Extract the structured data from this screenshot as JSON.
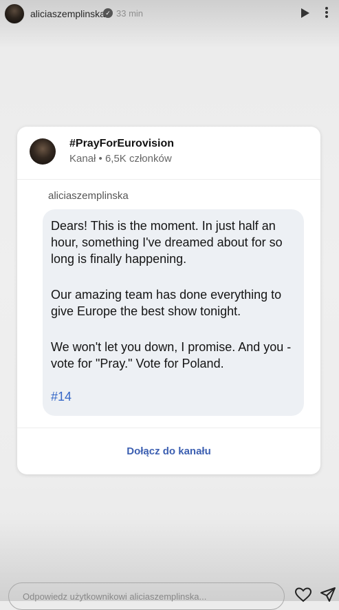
{
  "header": {
    "username": "aliciaszemplinska",
    "time": "33 min"
  },
  "card": {
    "channel_name": "#PrayForEurovision",
    "channel_meta": "Kanał • 6,5K członków",
    "post_author": "aliciaszemplinska",
    "message": {
      "paragraph1": "Dears! This is the moment. In just half an hour, something I've dreamed about for so long is finally happening.",
      "paragraph2": "Our amazing team has done everything to give Europe the best show tonight.",
      "paragraph3": "We won't let you down, I promise. And you - vote for \"Pray.\" Vote for Poland.",
      "hashtag": "#14"
    },
    "join_label": "Dołącz do kanału"
  },
  "reply": {
    "placeholder": "Odpowiedz użytkownikowi aliciaszemplinska..."
  },
  "colors": {
    "link": "#3567c7",
    "join": "#3c5fb1",
    "bubble": "#edf0f4"
  },
  "icons": [
    "verified-badge-icon",
    "play-icon",
    "more-icon",
    "heart-icon",
    "send-icon"
  ]
}
